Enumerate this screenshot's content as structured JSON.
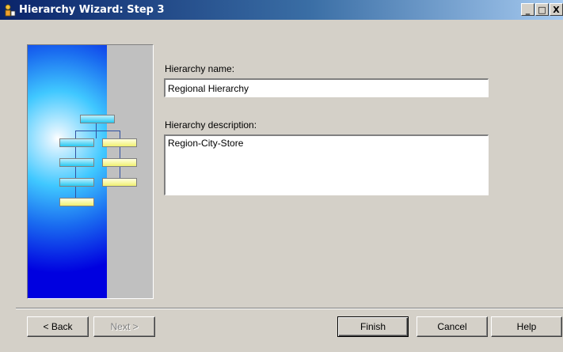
{
  "window": {
    "title": "Hierarchy Wizard: Step 3",
    "controls": {
      "minimize": "_",
      "maximize": "□",
      "close": "X"
    }
  },
  "form": {
    "name_label": "Hierarchy name:",
    "name_value": "Regional Hierarchy",
    "description_label": "Hierarchy description:",
    "description_value": "Region-City-Store"
  },
  "buttons": {
    "back": "< Back",
    "next": "Next >",
    "finish": "Finish",
    "cancel": "Cancel",
    "help": "Help"
  },
  "icons": {
    "app": "hierarchy-wizard-icon",
    "illustration": "hierarchy-chart-graphic"
  },
  "colors": {
    "titlebar_start": "#0a246a",
    "titlebar_end": "#a6caf0",
    "dialog_bg": "#d4d0c8"
  }
}
